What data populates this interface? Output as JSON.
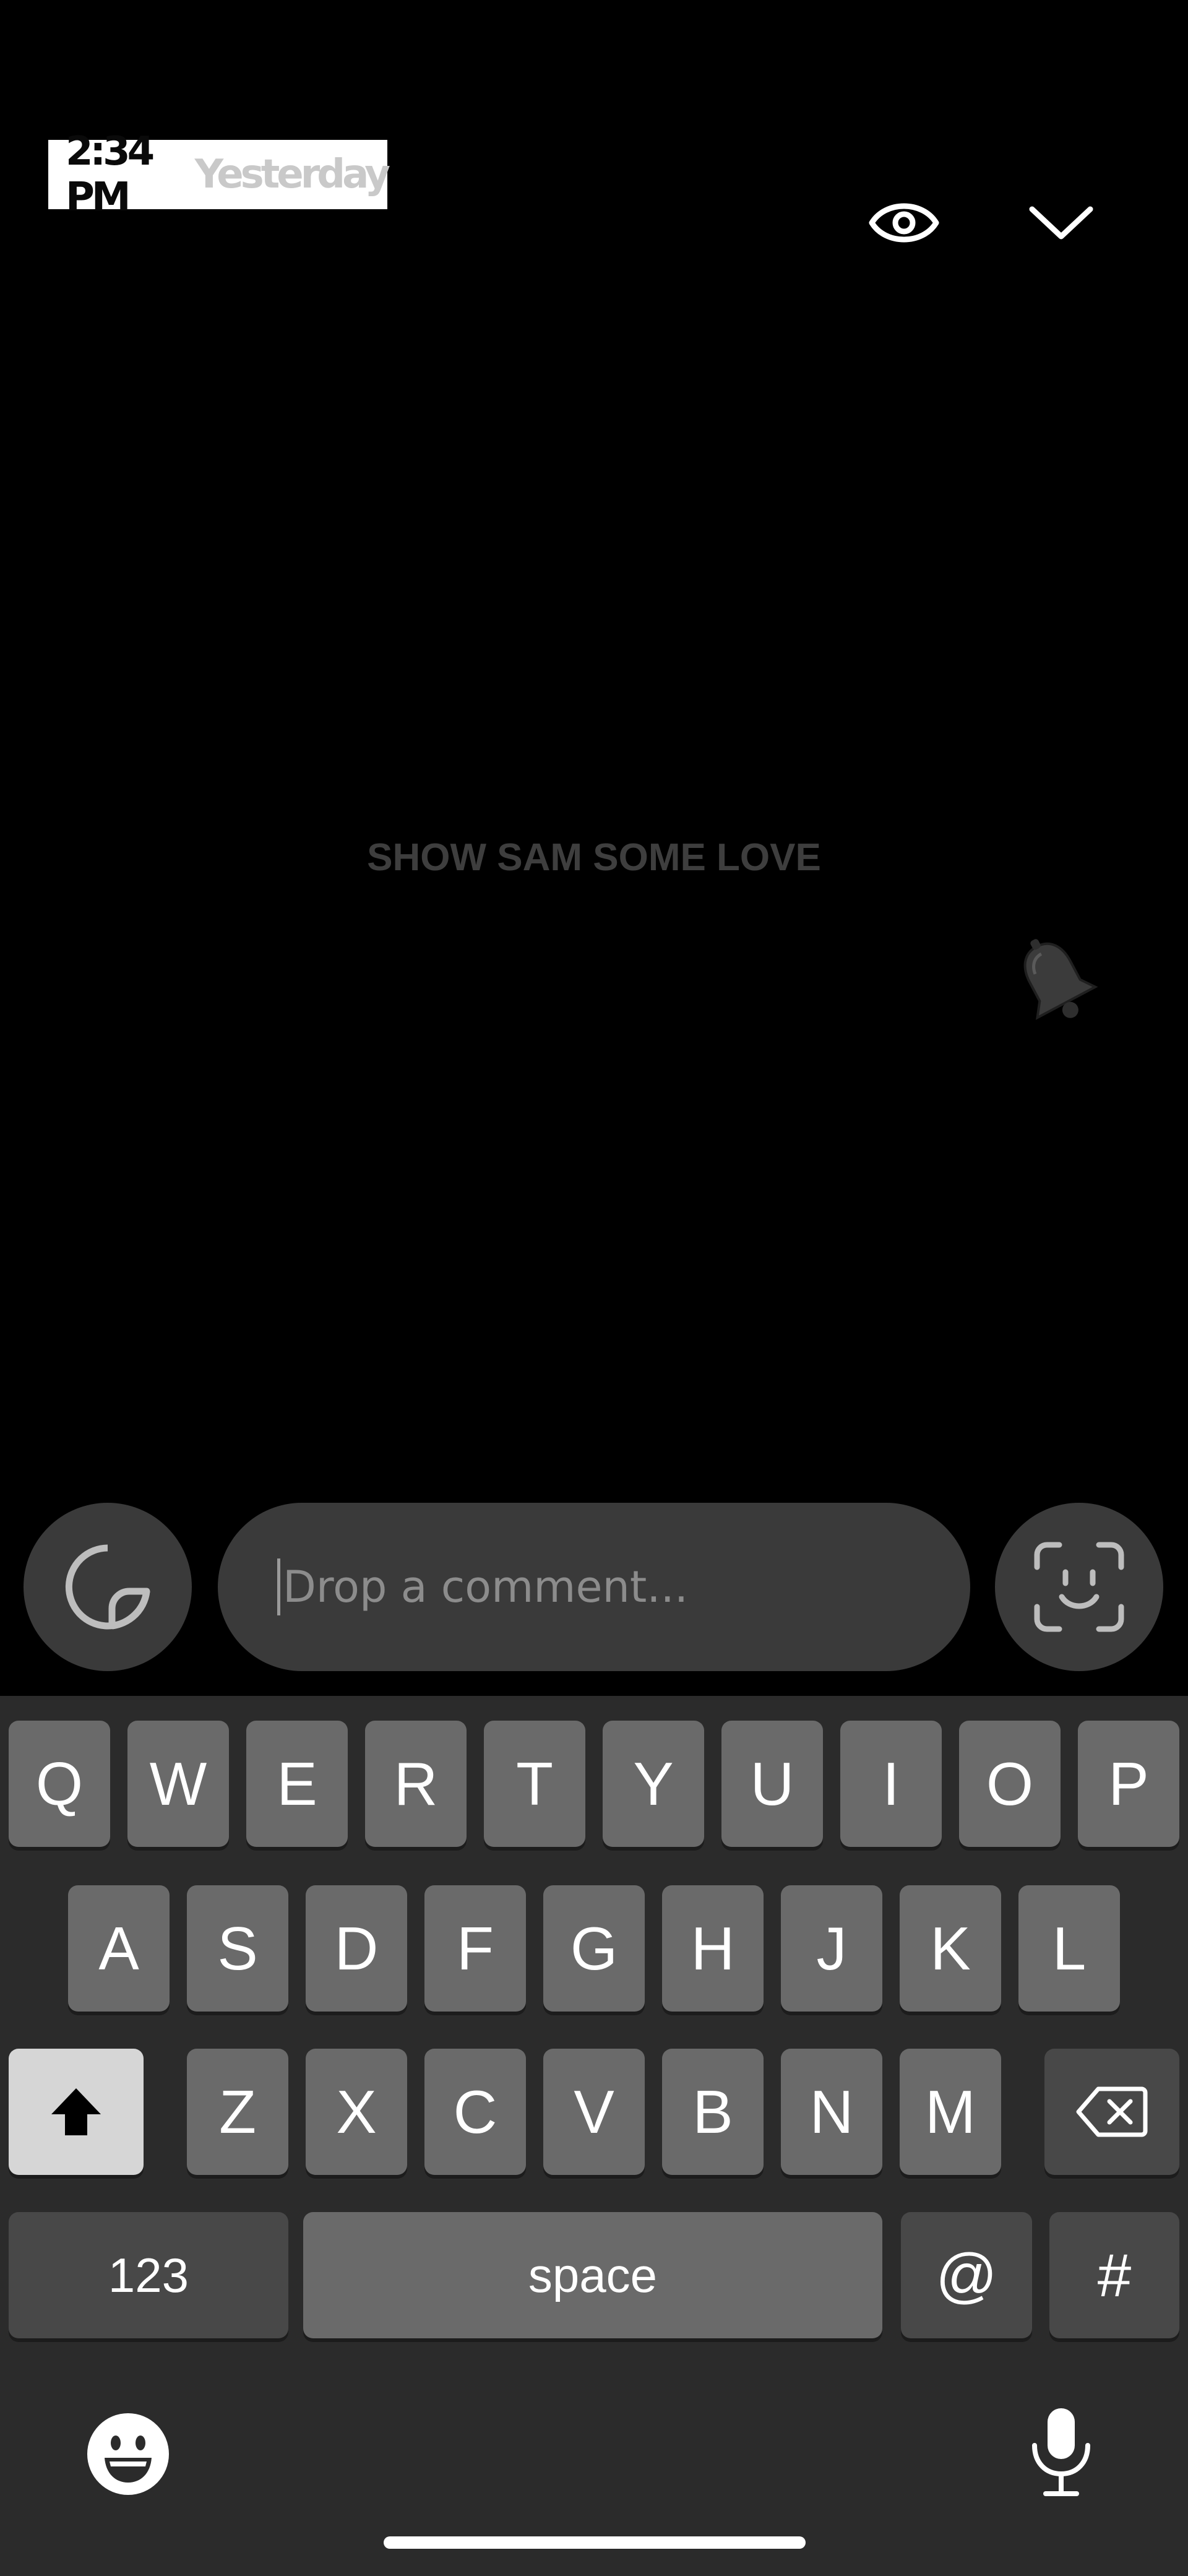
{
  "header": {
    "time": "2:34 PM",
    "when": "Yesterday"
  },
  "icons": {
    "views": "eye-icon",
    "collapse": "chevron-down-icon",
    "sticker": "sticker-icon",
    "face": "face-scan-icon",
    "bell": "bell-icon",
    "shift": "shift-arrow-icon",
    "backspace": "backspace-icon",
    "emoji": "emoji-icon",
    "mic": "microphone-icon"
  },
  "content": {
    "message": "SHOW SAM SOME LOVE"
  },
  "comment": {
    "placeholder": "Drop a comment..."
  },
  "keyboard": {
    "row1": [
      "Q",
      "W",
      "E",
      "R",
      "T",
      "Y",
      "U",
      "I",
      "O",
      "P"
    ],
    "row2": [
      "A",
      "S",
      "D",
      "F",
      "G",
      "H",
      "J",
      "K",
      "L"
    ],
    "row3": [
      "Z",
      "X",
      "C",
      "V",
      "B",
      "N",
      "M"
    ],
    "numbers_label": "123",
    "space_label": "space",
    "at_label": "@",
    "hash_label": "#"
  },
  "colors": {
    "background": "#000000",
    "keyboard_bg": "#2b2b2b",
    "key_bg": "#6a6a6a",
    "field_bg": "#3a3a3a"
  }
}
